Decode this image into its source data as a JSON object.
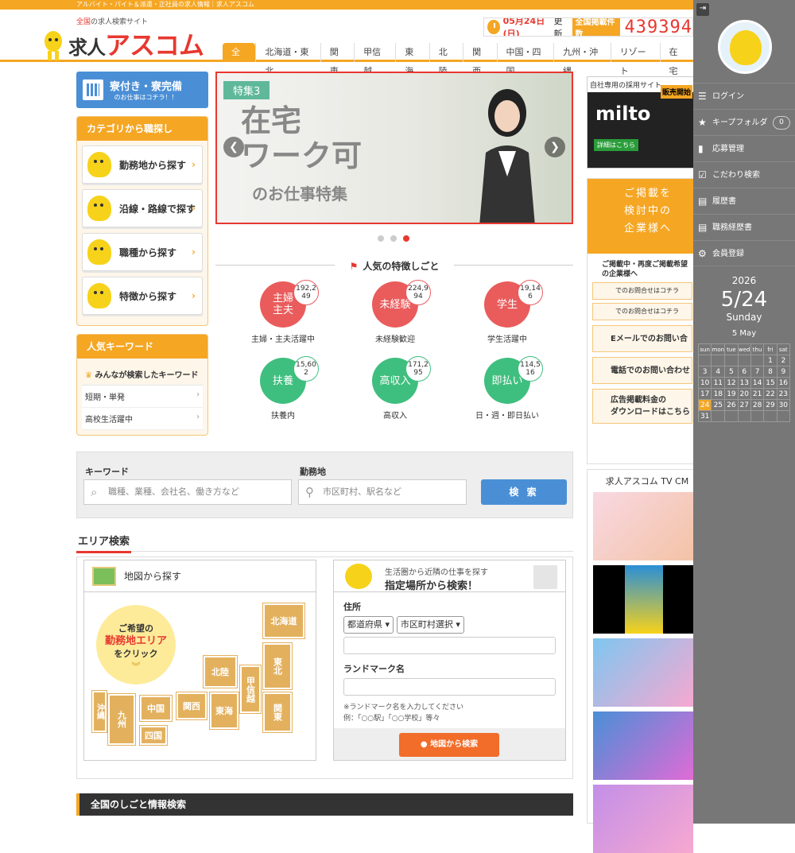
{
  "topbar": {
    "text": "アルバイト・パイト＆派遣・正社員の求人情報｜求人アスコム"
  },
  "header": {
    "tag_prefix": "全国",
    "tag_rest": "の求人検索サイト",
    "logo_kanji": "求人",
    "logo_kana": "アスコム",
    "date": "05月24日(日)",
    "updated": "更新",
    "count_label": "全国掲載件数",
    "count": "439394"
  },
  "nav": [
    "全国",
    "北海道・東北",
    "関東",
    "甲信越",
    "東海",
    "北陸",
    "関西",
    "中国・四国",
    "九州・沖縄",
    "リゾート",
    "在宅"
  ],
  "left": {
    "dorm_title": "寮付き・寮完備",
    "dorm_sub": "のお仕事はコチラ！！",
    "cat_title": "カテゴリから職探し",
    "cats": [
      "勤務地から探す",
      "沿線・路線で探す",
      "職種から探す",
      "特徴から探す"
    ],
    "kw_title": "人気キーワード",
    "kw_sub": "みんなが検索したキーワード",
    "kws": [
      "短期・単発",
      "高校生活躍中"
    ]
  },
  "slider": {
    "tag": "特集3",
    "line1": "在宅\nワーク可",
    "line2": "のお仕事特集",
    "prev": "❮",
    "next": "❯"
  },
  "popular": {
    "title": "人気の特徴しごと",
    "items": [
      {
        "label": "主婦\n主夫",
        "count": "192,249",
        "caption": "主婦・主夫活躍中",
        "color": "red"
      },
      {
        "label": "未経験",
        "count": "224,994",
        "caption": "未経験歓迎",
        "color": "red"
      },
      {
        "label": "学生",
        "count": "19,146",
        "caption": "学生活躍中",
        "color": "red"
      },
      {
        "label": "扶養",
        "count": "15,602",
        "caption": "扶養内",
        "color": "green"
      },
      {
        "label": "高収入",
        "count": "171,295",
        "caption": "高収入",
        "color": "green"
      },
      {
        "label": "即払い",
        "count": "114,516",
        "caption": "日・週・即日払い",
        "color": "green"
      }
    ]
  },
  "search": {
    "kw_label": "キーワード",
    "kw_placeholder": "職種、業種、会社名、働き方など",
    "loc_label": "勤務地",
    "loc_placeholder": "市区町村、駅名など",
    "btn": "検 索"
  },
  "area": {
    "title": "エリア検索",
    "map_title": "地図から探す",
    "click1": "ご希望の",
    "click2": "勤務地エリア",
    "click3": "をクリック",
    "chev": "︾",
    "regions": [
      "北海道",
      "東北",
      "甲信越",
      "北陸",
      "関東",
      "東海",
      "関西",
      "中国",
      "四国",
      "九州",
      "沖縄"
    ],
    "loc_t1": "生活圏から近隣の仕事を探す",
    "loc_t2": "指定場所から検索！",
    "addr": "住所",
    "pref": "都道府県",
    "city": "市区町村選択",
    "landmark": "ランドマーク名",
    "note1": "※ランドマーク名を入力してください",
    "note2": "例：「○○駅」「○○学校」等々",
    "map_btn": "地図から検索"
  },
  "nation": "全国のしごと情報検索",
  "right": {
    "ad_head": "自社専用の採用サイト",
    "ad_brand": "milto",
    "ad_tag": "販売開始",
    "ad_detail": "詳細はこちら",
    "post1": "ご掲載を",
    "post2": "検討中の",
    "post3": "企業様へ",
    "info1": "ご掲載中・再度ご掲載希望",
    "info2": "の企業様へ",
    "c1": "でのお問合せはコチラ",
    "c2": "でのお問合せはコチラ",
    "b1": "Eメールでのお問い合わせ",
    "b2": "電話でのお問い合わせ",
    "b3a": "広告掲載料金の",
    "b3b": "ダウンロードはこちら",
    "tv": "求人アスコム TV CM"
  },
  "sidebar": {
    "toggle": "⇥",
    "items": [
      "ログイン",
      "キープフォルダ",
      "応募管理",
      "こだわり検索",
      "履歴書",
      "職務経歴書",
      "会員登録"
    ],
    "keep_count": "0",
    "year": "2026",
    "date": "5/24",
    "weekday": "Sunday",
    "month": "5 May",
    "wd": [
      "sun",
      "mon",
      "tue",
      "wed",
      "thu",
      "fri",
      "sat"
    ],
    "days": [
      [
        "",
        "",
        "",
        "",
        "",
        "1",
        "2"
      ],
      [
        "3",
        "4",
        "5",
        "6",
        "7",
        "8",
        "9"
      ],
      [
        "10",
        "11",
        "12",
        "13",
        "14",
        "15",
        "16"
      ],
      [
        "17",
        "18",
        "19",
        "20",
        "21",
        "22",
        "23"
      ],
      [
        "24",
        "25",
        "26",
        "27",
        "28",
        "29",
        "30"
      ],
      [
        "31",
        "",
        "",
        "",
        "",
        "",
        ""
      ]
    ],
    "today": "24"
  },
  "colors": {
    "accent": "#f5a623",
    "red": "#e8382f",
    "blue": "#4a8fd6",
    "green": "#3fbf7f"
  }
}
